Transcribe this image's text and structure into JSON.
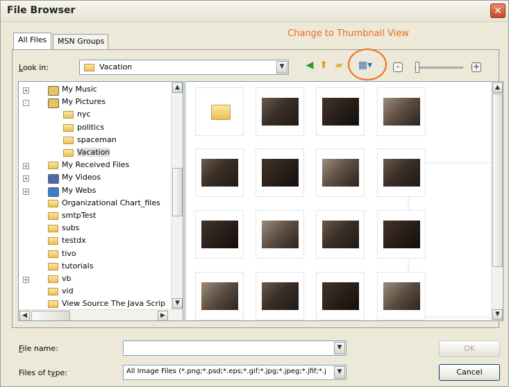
{
  "window": {
    "title": "File Browser"
  },
  "annotation": "Change to Thumbnail View",
  "tabs": [
    {
      "label": "All Files"
    },
    {
      "label": "MSN Groups"
    }
  ],
  "lookin": {
    "label_prefix": "L",
    "label_rest": "ook in:",
    "value": "Vacation"
  },
  "toolbar": {
    "back_icon": "back-arrow-icon",
    "up_icon": "up-one-level-icon",
    "new_folder_icon": "new-folder-icon",
    "views_icon": "views-menu-icon",
    "zoom_out": "-",
    "zoom_in": "+"
  },
  "tree": {
    "items": [
      {
        "label": "My Music",
        "icon": "music-folder-icon",
        "expander": "+"
      },
      {
        "label": "My Pictures",
        "icon": "pictures-folder-icon",
        "expander": "-"
      },
      {
        "label": "nyc",
        "icon": "folder-icon",
        "expander": ""
      },
      {
        "label": "politics",
        "icon": "folder-icon",
        "expander": ""
      },
      {
        "label": "spaceman",
        "icon": "folder-icon",
        "expander": ""
      },
      {
        "label": "Vacation",
        "icon": "folder-icon",
        "expander": ""
      },
      {
        "label": "My Received Files",
        "icon": "folder-icon",
        "expander": "+"
      },
      {
        "label": "My Videos",
        "icon": "videos-folder-icon",
        "expander": "+"
      },
      {
        "label": "My Webs",
        "icon": "webs-folder-icon",
        "expander": "+"
      },
      {
        "label": "Organizational Chart_files",
        "icon": "folder-icon",
        "expander": ""
      },
      {
        "label": "smtpTest",
        "icon": "folder-icon",
        "expander": ""
      },
      {
        "label": "subs",
        "icon": "folder-icon",
        "expander": ""
      },
      {
        "label": "testdx",
        "icon": "folder-icon",
        "expander": ""
      },
      {
        "label": "tivo",
        "icon": "folder-icon",
        "expander": ""
      },
      {
        "label": "tutorials",
        "icon": "folder-icon",
        "expander": ""
      },
      {
        "label": "vb",
        "icon": "folder-icon",
        "expander": "+"
      },
      {
        "label": "vid",
        "icon": "folder-icon",
        "expander": ""
      },
      {
        "label": "View Source The Java Scrip",
        "icon": "folder-icon",
        "expander": ""
      }
    ]
  },
  "thumbnails": [
    {
      "type": "folder"
    },
    {
      "type": "photo"
    },
    {
      "type": "photo"
    },
    {
      "type": "photo"
    },
    {
      "type": "photo"
    },
    {
      "type": "photo"
    },
    {
      "type": "photo"
    },
    {
      "type": "photo"
    },
    {
      "type": "photo"
    },
    {
      "type": "photo"
    },
    {
      "type": "photo"
    },
    {
      "type": "photo"
    },
    {
      "type": "photo"
    },
    {
      "type": "photo"
    },
    {
      "type": "photo"
    },
    {
      "type": "photo"
    }
  ],
  "filename": {
    "label_prefix": "F",
    "label_rest": "ile name:",
    "value": ""
  },
  "filetype": {
    "label_prefix": "Files of t",
    "label_u": "y",
    "label_rest": "pe:",
    "value": "All Image Files (*.png;*.psd;*.eps;*.gif;*.jpg;*.jpeg;*.jfif;*.j"
  },
  "buttons": {
    "ok": "OK",
    "cancel": "Cancel"
  },
  "colors": {
    "annotation": "#f06a1e",
    "selection": "#e1e1e1"
  }
}
